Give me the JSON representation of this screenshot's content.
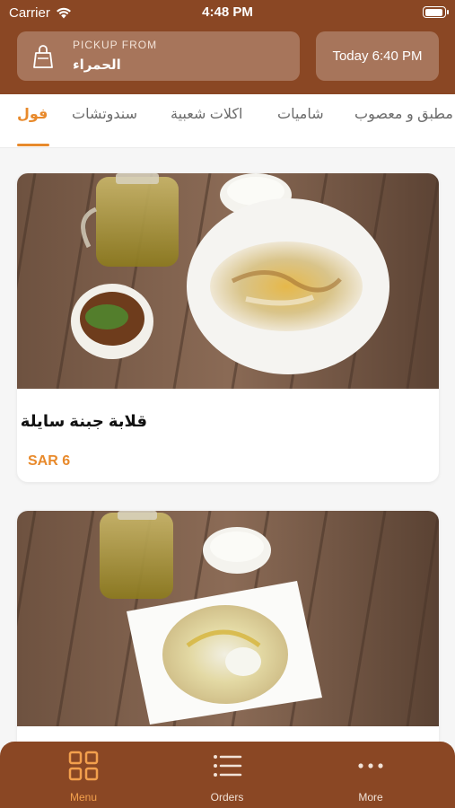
{
  "status_bar": {
    "carrier": "Carrier",
    "time": "4:48 PM"
  },
  "header": {
    "pickup_label": "PICKUP FROM",
    "pickup_location": "الحمراء",
    "pickup_time": "Today 6:40 PM"
  },
  "tabs": [
    {
      "label": "فول",
      "active": true
    },
    {
      "label": "سندوتشات",
      "active": false
    },
    {
      "label": "اكلات شعبية",
      "active": false
    },
    {
      "label": "شاميات",
      "active": false
    },
    {
      "label": "مطبق و معصوب",
      "active": false
    }
  ],
  "items": [
    {
      "title": "قلابة جبنة سايلة",
      "price": "SAR 6",
      "image_icon": "food-photo-icon"
    },
    {
      "title": "",
      "price": "",
      "image_icon": "food-photo-icon"
    }
  ],
  "bottom_nav": [
    {
      "label": "Menu",
      "icon": "grid-icon",
      "active": true
    },
    {
      "label": "Orders",
      "icon": "list-icon",
      "active": false
    },
    {
      "label": "More",
      "icon": "more-dots-icon",
      "active": false
    }
  ],
  "colors": {
    "brand": "#8a4724",
    "accent": "#e88a2c"
  }
}
